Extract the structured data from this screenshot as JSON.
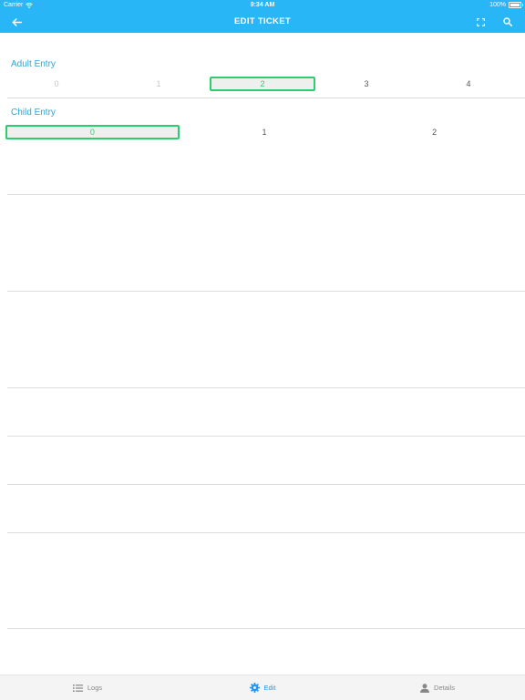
{
  "status_bar": {
    "carrier": "Carrier",
    "time": "9:34 AM",
    "battery": "100%"
  },
  "nav": {
    "title": "EDIT TICKET",
    "back_icon": "back-arrow-icon",
    "fullscreen_icon": "fullscreen-icon",
    "search_icon": "search-icon"
  },
  "adult_entry": {
    "label": "Adult Entry",
    "options": [
      "0",
      "1",
      "2",
      "3",
      "4"
    ],
    "selected": "2"
  },
  "child_entry": {
    "label": "Child Entry",
    "options": [
      "0",
      "1",
      "2"
    ],
    "selected": "0"
  },
  "tabs": [
    {
      "label": "Logs",
      "icon": "list-icon",
      "active": false
    },
    {
      "label": "Edit",
      "icon": "gear-icon",
      "active": true
    },
    {
      "label": "Details",
      "icon": "person-icon",
      "active": false
    }
  ],
  "colors": {
    "accent": "#29b6f6",
    "selected_border": "#2ecc71",
    "section_label": "#2aa8d8",
    "tab_active": "#2196f3"
  }
}
